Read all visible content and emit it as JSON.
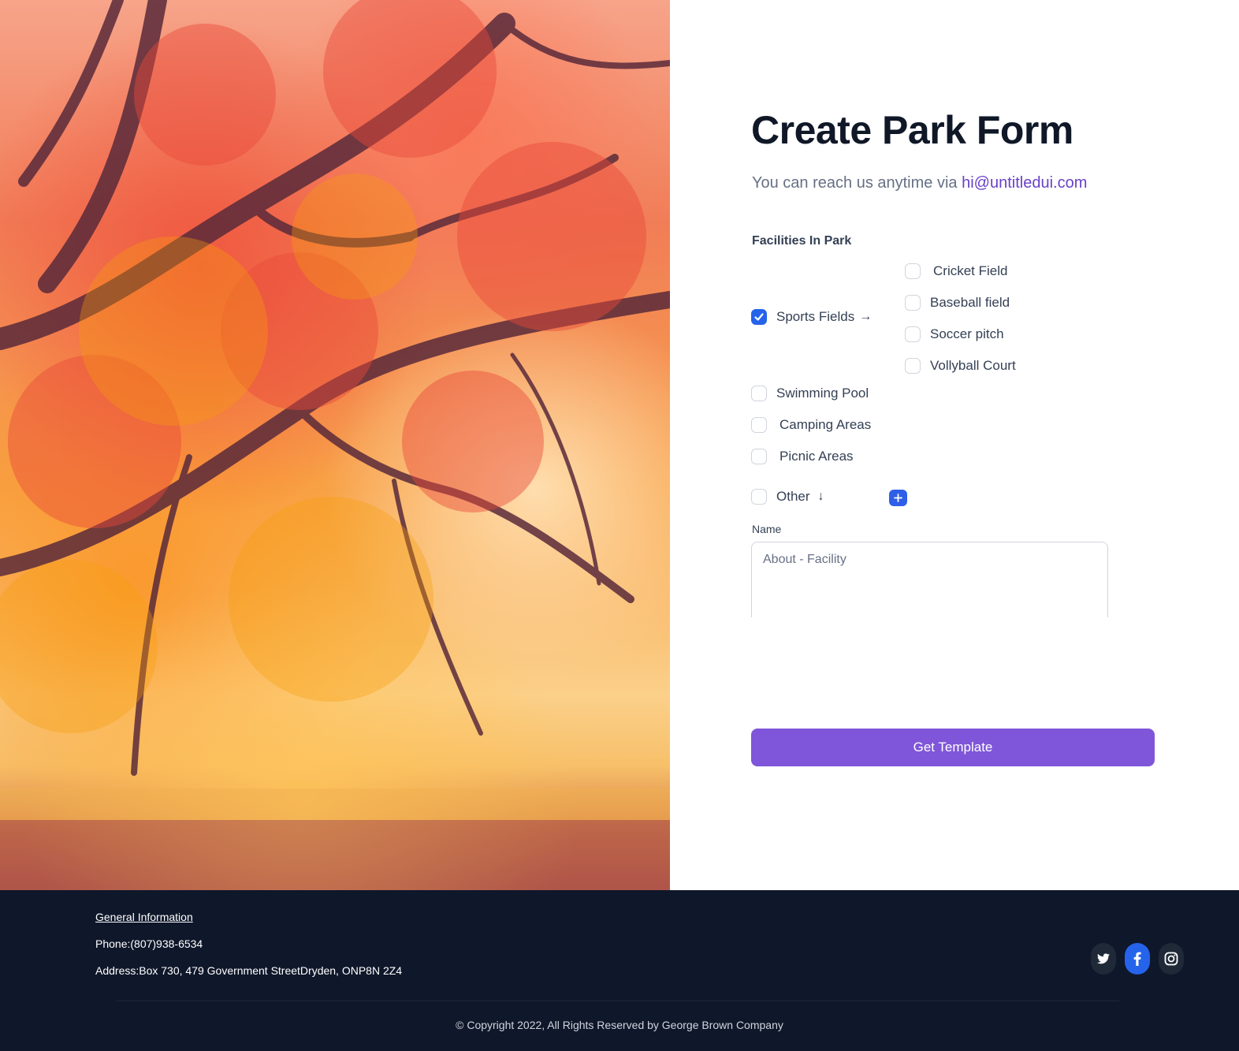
{
  "form": {
    "title": "Create Park Form",
    "subtitle_prefix": "You can reach us anytime via ",
    "contact_email": "hi@untitledui.com",
    "facilities_label": "Facilities In  Park",
    "facilities": [
      {
        "label": "Sports Fields",
        "checked": true,
        "suffix": "→"
      },
      {
        "label": "Swimming Pool",
        "checked": false
      },
      {
        "label": "Camping Areas",
        "checked": false
      },
      {
        "label": "Picnic Areas",
        "checked": false
      },
      {
        "label": "Other",
        "checked": false,
        "suffix": "↓"
      }
    ],
    "sports_options": [
      {
        "label": "Cricket Field",
        "checked": false
      },
      {
        "label": "Baseball field",
        "checked": false
      },
      {
        "label": "Soccer pitch",
        "checked": false
      },
      {
        "label": "Vollyball Court",
        "checked": false
      }
    ],
    "add_button_icon": "plus-icon",
    "name_label": "Name",
    "name_placeholder": "About - Facility",
    "submit_label": "Get Template"
  },
  "footer": {
    "info_title": "General Information",
    "phone": "Phone:(807)938-6534",
    "address": "Address:Box 730, 479 Government StreetDryden, ONP8N 2Z4",
    "social": [
      {
        "name": "twitter",
        "icon": "twitter-icon"
      },
      {
        "name": "facebook",
        "icon": "facebook-icon"
      },
      {
        "name": "instagram",
        "icon": "instagram-icon"
      }
    ],
    "copyright": "© Copyright 2022, All Rights Reserved by George Brown Company"
  },
  "colors": {
    "accent_purple": "#7f56d9",
    "link_purple": "#6941c6",
    "checkbox_blue": "#2563eb",
    "footer_bg": "#0f172a"
  }
}
